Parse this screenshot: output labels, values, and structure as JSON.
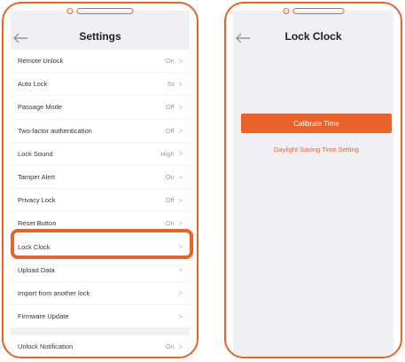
{
  "left": {
    "header": {
      "title": "Settings"
    },
    "rows": [
      {
        "label": "Remote Unlock",
        "value": "On"
      },
      {
        "label": "Auto Lock",
        "value": "5s"
      },
      {
        "label": "Passage Mode",
        "value": "Off"
      },
      {
        "label": "Two-factor authentication",
        "value": "Off"
      },
      {
        "label": "Lock Sound",
        "value": "High"
      },
      {
        "label": "Tamper Alert",
        "value": "On"
      },
      {
        "label": "Privacy Lock",
        "value": "Off"
      },
      {
        "label": "Reset Button",
        "value": "On"
      },
      {
        "label": "Lock Clock",
        "value": ""
      },
      {
        "label": "Upload Data",
        "value": ""
      },
      {
        "label": "Import from another lock",
        "value": ""
      },
      {
        "label": "Firmware Update",
        "value": ""
      },
      {
        "label": "Unlock Notification",
        "value": "On"
      }
    ]
  },
  "right": {
    "header": {
      "title": "Lock Clock"
    },
    "calibrate_label": "Calibrate Time",
    "dst_label": "Daylight Saving Time Setting"
  },
  "colors": {
    "accent": "#e8622a",
    "background": "#efeff4"
  },
  "icons": {
    "back": "arrow-left-icon",
    "chevron": "chevron-right-icon"
  }
}
